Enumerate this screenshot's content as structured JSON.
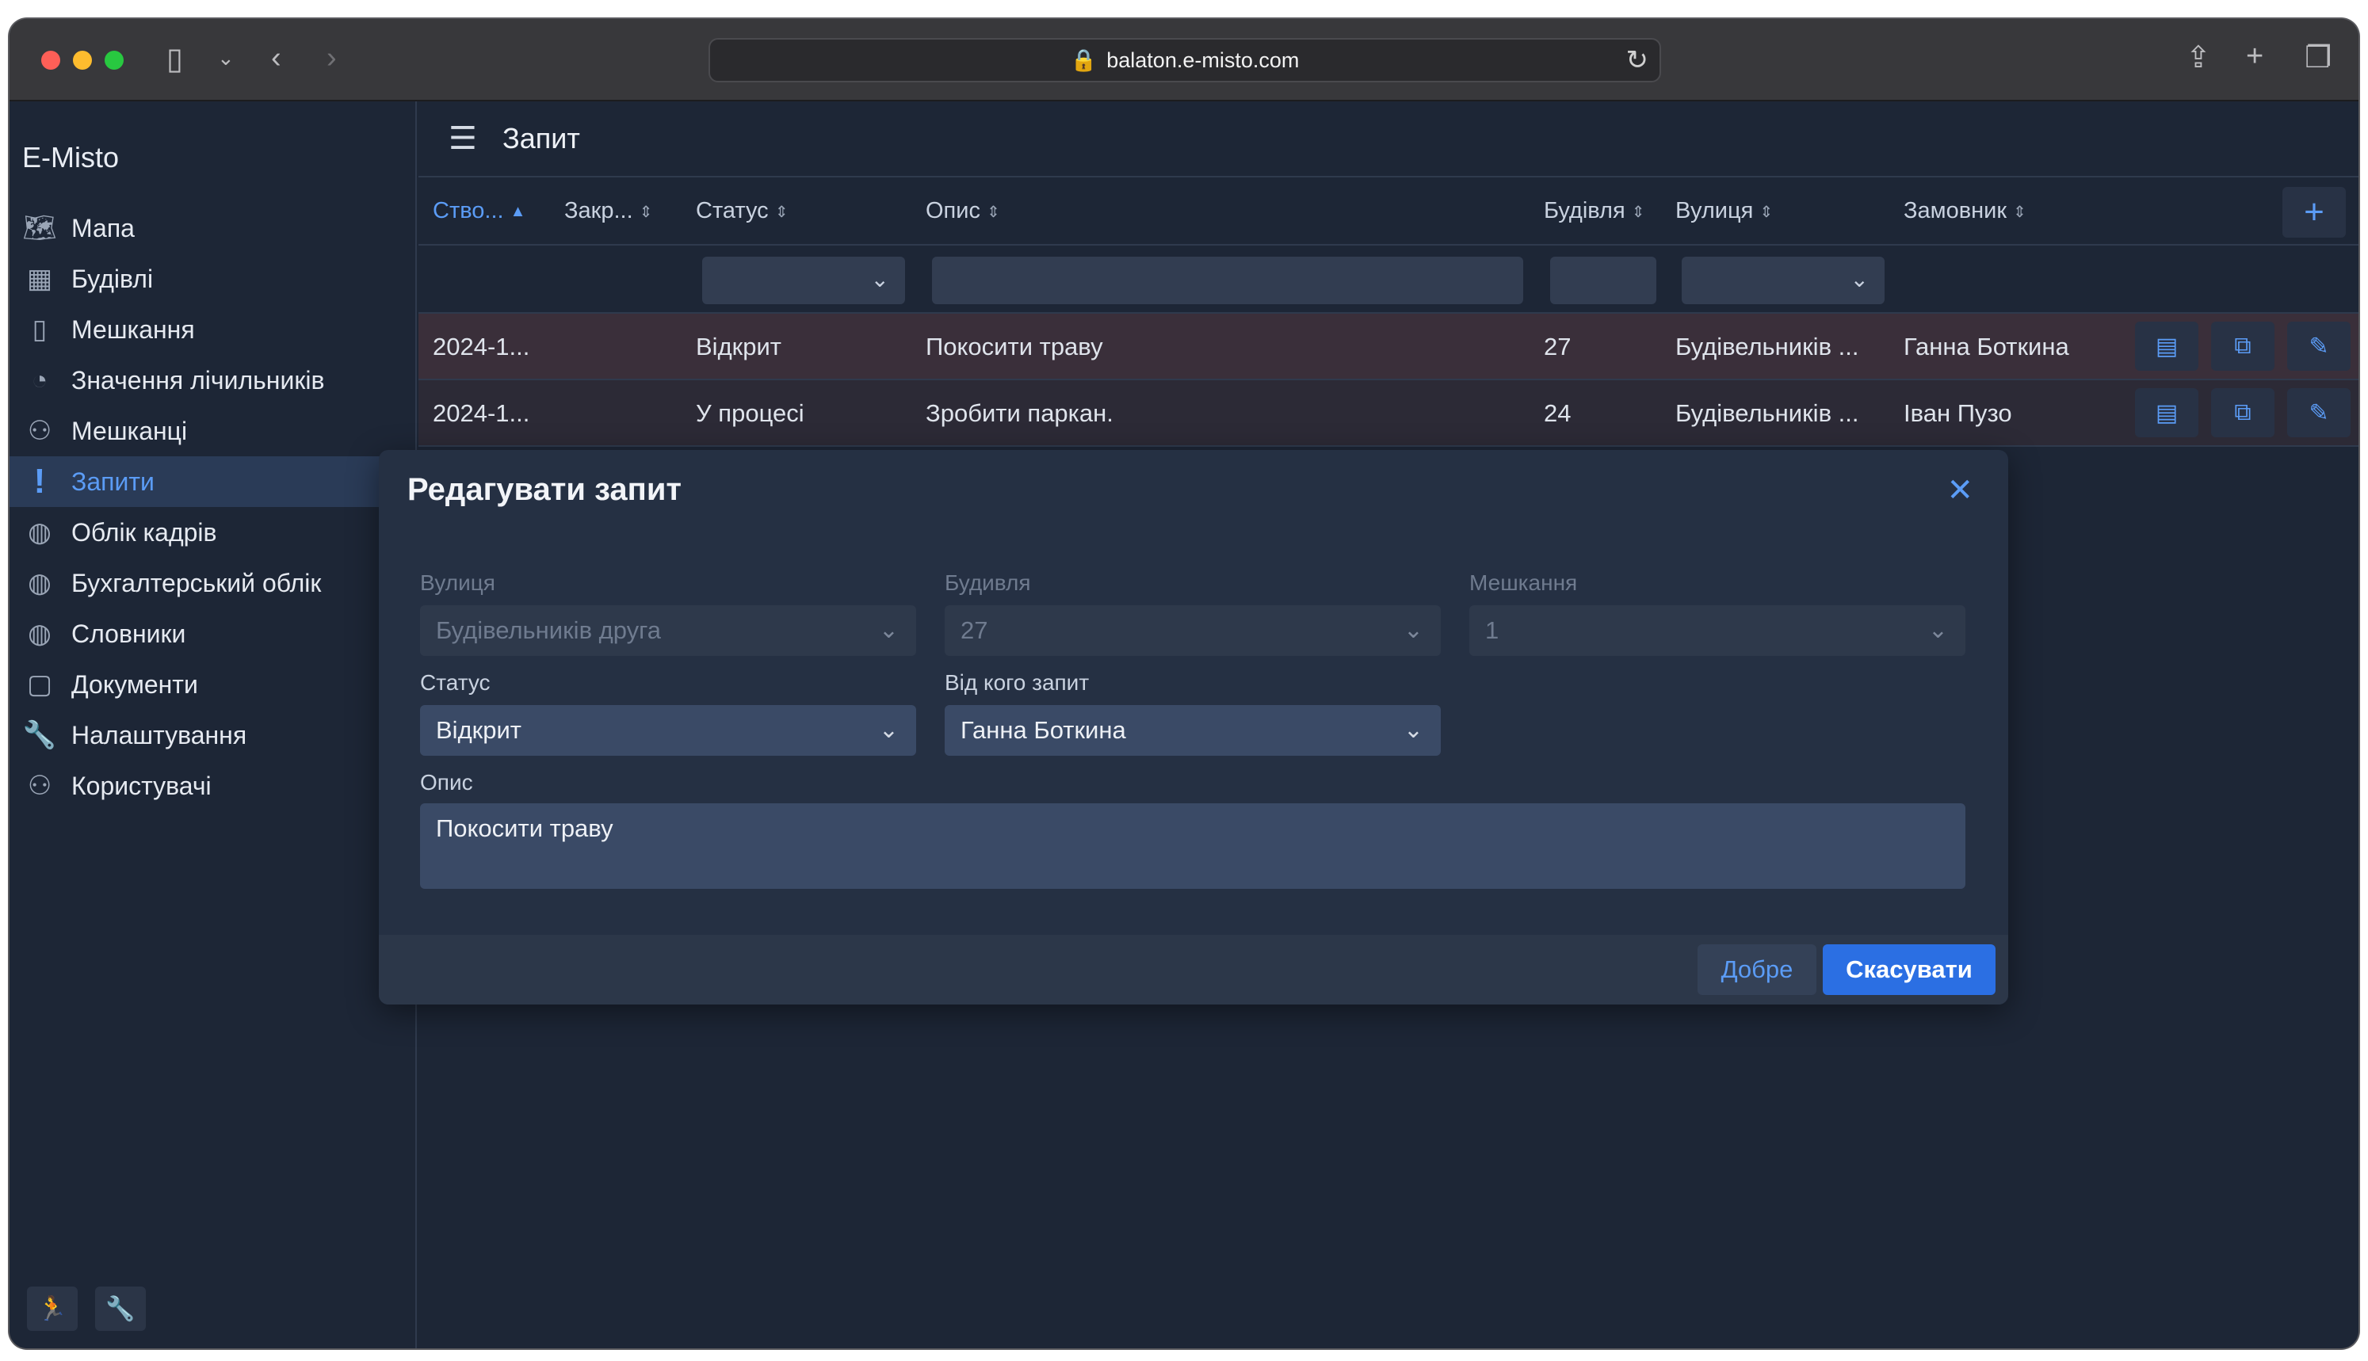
{
  "browser": {
    "url": "balaton.e-misto.com"
  },
  "app": {
    "brand": "E-Misto",
    "page_title": "Запит"
  },
  "sidebar": {
    "items": [
      {
        "label": "Мапа",
        "icon": "map-icon",
        "glyph": "🗺"
      },
      {
        "label": "Будівлі",
        "icon": "building-icon",
        "glyph": "▦"
      },
      {
        "label": "Мешкання",
        "icon": "door-icon",
        "glyph": "▯"
      },
      {
        "label": "Значення лічильників",
        "icon": "gauge-icon",
        "glyph": "◔"
      },
      {
        "label": "Мешканці",
        "icon": "people-icon",
        "glyph": "⚇"
      },
      {
        "label": "Запити",
        "icon": "exclamation-icon",
        "glyph": "!",
        "active": true
      },
      {
        "label": "Облік кадрів",
        "icon": "globe-icon",
        "glyph": "◍"
      },
      {
        "label": "Бухгалтерський облік",
        "icon": "globe-icon",
        "glyph": "◍"
      },
      {
        "label": "Словники",
        "icon": "globe-icon",
        "glyph": "◍"
      },
      {
        "label": "Документи",
        "icon": "document-icon",
        "glyph": "▢"
      },
      {
        "label": "Налаштування",
        "icon": "wrench-icon",
        "glyph": "🔧"
      },
      {
        "label": "Користувачі",
        "icon": "users-icon",
        "glyph": "⚇"
      }
    ]
  },
  "table": {
    "columns": [
      "Ство...",
      "Закр...",
      "Статус",
      "Опис",
      "Будівля",
      "Вулиця",
      "Замовник"
    ],
    "rows": [
      {
        "created": "2024-1...",
        "closed": "",
        "status": "Відкрит",
        "description": "Покосити траву",
        "building": "27",
        "street": "Будівельників ...",
        "customer": "Ганна Боткина"
      },
      {
        "created": "2024-1...",
        "closed": "",
        "status": "У процесі",
        "description": "Зробити паркан.",
        "building": "24",
        "street": "Будівельників ...",
        "customer": "Іван Пузо"
      }
    ]
  },
  "modal": {
    "title": "Редагувати запит",
    "street_label": "Вулиця",
    "street_value": "Будівельників друга",
    "building_label": "Будивля",
    "building_value": "27",
    "apartment_label": "Мешкання",
    "apartment_value": "1",
    "status_label": "Статус",
    "status_value": "Відкрит",
    "from_label": "Від кого запит",
    "from_value": "Ганна Боткина",
    "description_label": "Опис",
    "description_value": "Покосити траву",
    "ok_label": "Добре",
    "cancel_label": "Скасувати"
  },
  "colors": {
    "accent": "#5b9cf6",
    "primary_button": "#2b6fe3",
    "background": "#1d2636"
  }
}
